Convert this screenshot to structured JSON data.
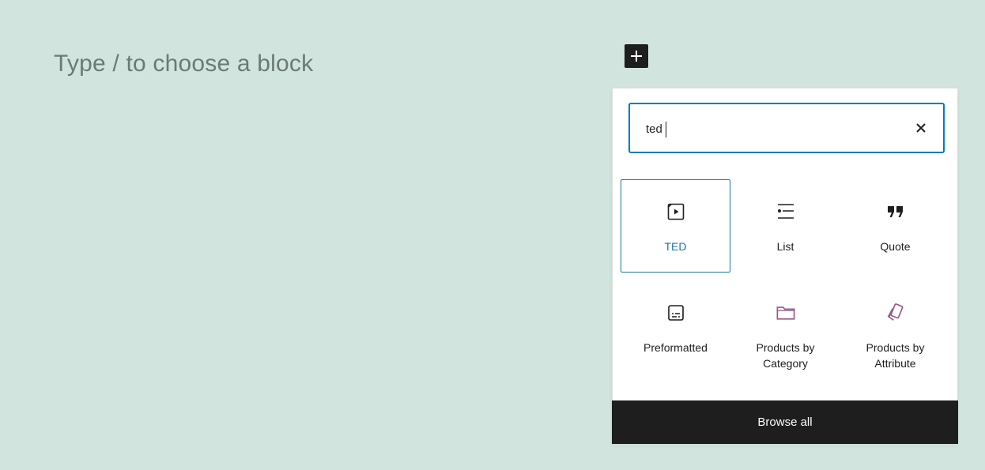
{
  "editor": {
    "placeholder": "Type / to choose a block"
  },
  "inserter": {
    "toggle_icon": "plus-icon",
    "search": {
      "value": "ted",
      "clear_icon": "close-icon"
    },
    "blocks": [
      {
        "label": "TED",
        "icon": "embed-video-icon",
        "selected": true
      },
      {
        "label": "List",
        "icon": "list-icon",
        "selected": false
      },
      {
        "label": "Quote",
        "icon": "quote-icon",
        "selected": false
      },
      {
        "label": "Preformatted",
        "icon": "preformatted-icon",
        "selected": false
      },
      {
        "label": "Products by Category",
        "icon": "folder-icon",
        "selected": false
      },
      {
        "label": "Products by Attribute",
        "icon": "tags-icon",
        "selected": false
      }
    ],
    "browse_all_label": "Browse all"
  },
  "colors": {
    "background": "#d2e4de",
    "accent": "#007cba",
    "woo_purple": "#96588a",
    "dark": "#1e1e1e"
  }
}
